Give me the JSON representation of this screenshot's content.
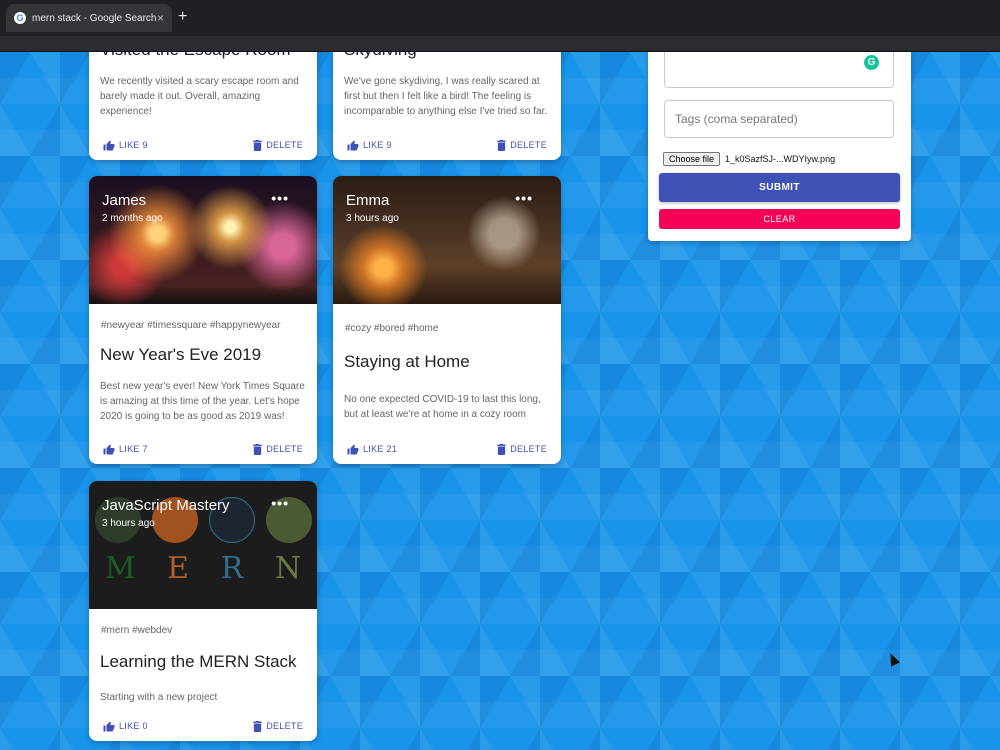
{
  "browser": {
    "tab_title": "mern stack - Google Search",
    "tab_favicon": "G",
    "close_glyph": "×",
    "newtab_glyph": "+"
  },
  "colors": {
    "primary": "#3f51b5",
    "secondary": "#f50057",
    "background": "#1894ea"
  },
  "posts": [
    {
      "creator": "",
      "time": "",
      "tags": "",
      "title": "Visited the Escape Room",
      "message": "We recently visited a scary escape room and barely made it out. Overall, amazing experience!",
      "like_label": "LIKE 9",
      "delete_label": "DELETE"
    },
    {
      "creator": "",
      "time": "",
      "tags": "",
      "title": "Skydiving",
      "message": "We've gone skydiving, I was really scared at first but then I felt like a bird! The feeling is incomparable to anything else I've tried so far.",
      "like_label": "LIKE 9",
      "delete_label": "DELETE"
    },
    {
      "creator": "James",
      "time": "2 months ago",
      "more": "•••",
      "tags": "#newyear #timessquare #happynewyear",
      "title": "New Year's Eve 2019",
      "message": "Best new year's ever! New York Times Square is amazing at this time of the year. Let's hope 2020 is going to be as good as 2019 was!",
      "like_label": "LIKE 7",
      "delete_label": "DELETE"
    },
    {
      "creator": "Emma",
      "time": "3 hours ago",
      "more": "•••",
      "tags": "#cozy #bored #home",
      "title": "Staying at Home",
      "message": "No one expected COVID-19 to last this long, but at least we're at home in a cozy room",
      "like_label": "LIKE 21",
      "delete_label": "DELETE"
    },
    {
      "creator": "JavaScript Mastery",
      "time": "3 hours ago",
      "more": "•••",
      "image_letters": [
        "M",
        "E",
        "R",
        "N"
      ],
      "tags": "#mern #webdev",
      "title": "Learning the MERN Stack",
      "message": "Starting with a new project",
      "like_label": "LIKE 0",
      "delete_label": "DELETE"
    }
  ],
  "form": {
    "grammarly_glyph": "G",
    "tags_placeholder": "Tags (coma separated)",
    "choose_file_label": "Choose file",
    "file_name": "1_k0SazfSJ-...WDYIyw.png",
    "submit_label": "SUBMIT",
    "clear_label": "CLEAR"
  }
}
